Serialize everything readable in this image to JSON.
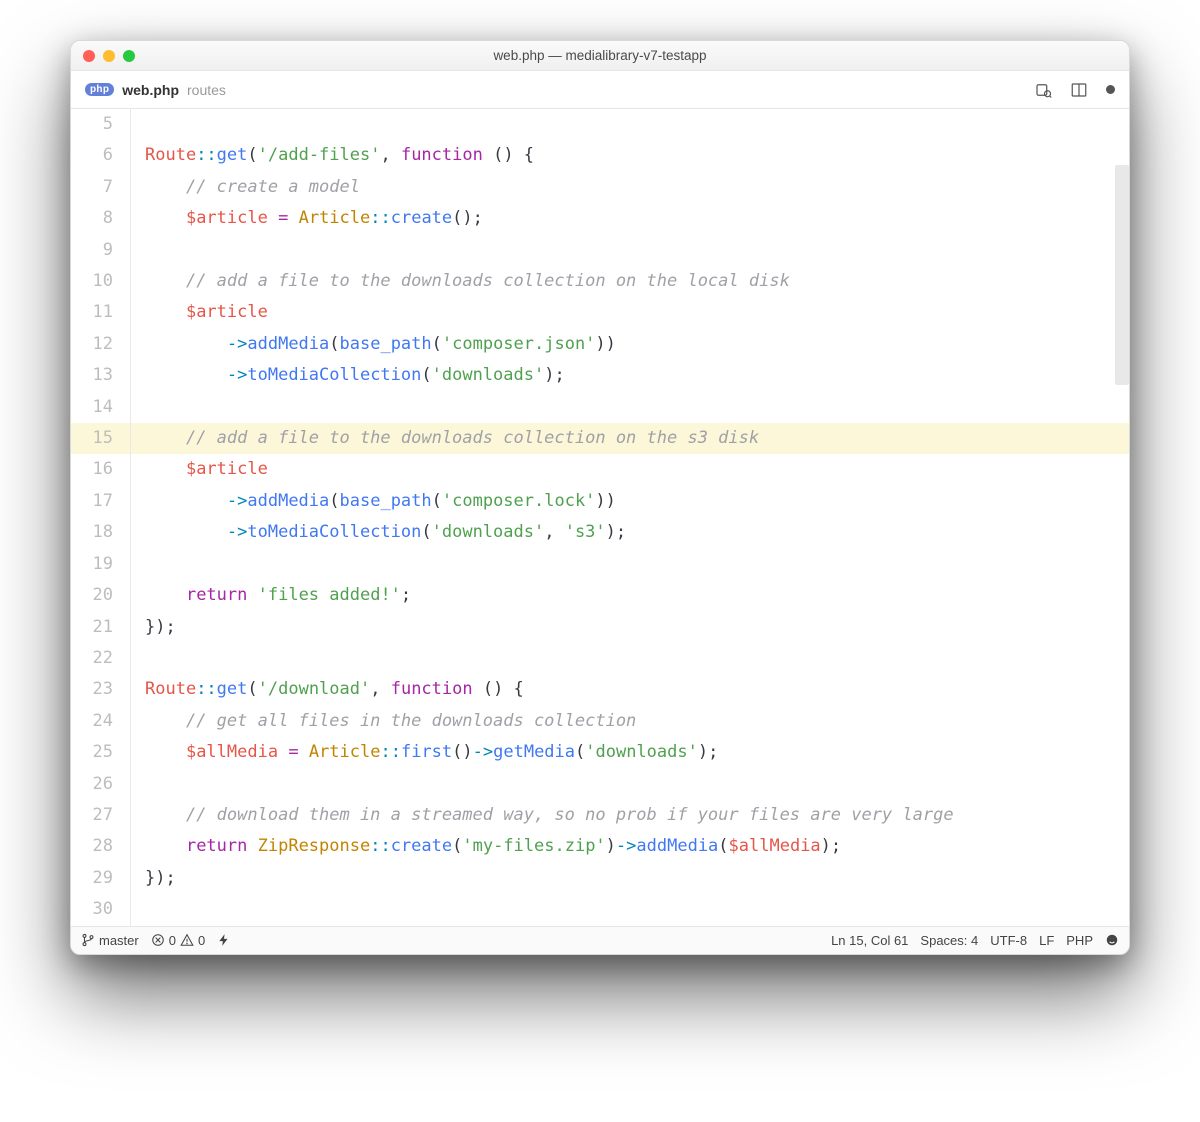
{
  "window": {
    "title": "web.php — medialibrary-v7-testapp"
  },
  "tab": {
    "icon_label": "php",
    "filename": "web.php",
    "path": "routes"
  },
  "editor": {
    "highlighted_line": 15,
    "lines": [
      {
        "n": 5,
        "tokens": []
      },
      {
        "n": 6,
        "tokens": [
          {
            "c": "name",
            "t": "Route"
          },
          {
            "c": "op",
            "t": "::"
          },
          {
            "c": "fn",
            "t": "get"
          },
          {
            "c": "p",
            "t": "("
          },
          {
            "c": "str",
            "t": "'/add-files'"
          },
          {
            "c": "p",
            "t": ", "
          },
          {
            "c": "kw",
            "t": "function"
          },
          {
            "c": "p",
            "t": " () {"
          }
        ]
      },
      {
        "n": 7,
        "tokens": [
          {
            "c": "p",
            "t": "    "
          },
          {
            "c": "comment",
            "t": "// create a model"
          }
        ]
      },
      {
        "n": 8,
        "tokens": [
          {
            "c": "p",
            "t": "    "
          },
          {
            "c": "name",
            "t": "$article"
          },
          {
            "c": "p",
            "t": " "
          },
          {
            "c": "kw",
            "t": "="
          },
          {
            "c": "p",
            "t": " "
          },
          {
            "c": "type",
            "t": "Article"
          },
          {
            "c": "op",
            "t": "::"
          },
          {
            "c": "fn",
            "t": "create"
          },
          {
            "c": "p",
            "t": "();"
          }
        ]
      },
      {
        "n": 9,
        "tokens": []
      },
      {
        "n": 10,
        "tokens": [
          {
            "c": "p",
            "t": "    "
          },
          {
            "c": "comment",
            "t": "// add a file to the downloads collection on the local disk"
          }
        ]
      },
      {
        "n": 11,
        "tokens": [
          {
            "c": "p",
            "t": "    "
          },
          {
            "c": "name",
            "t": "$article"
          }
        ]
      },
      {
        "n": 12,
        "tokens": [
          {
            "c": "p",
            "t": "        "
          },
          {
            "c": "op",
            "t": "->"
          },
          {
            "c": "fn",
            "t": "addMedia"
          },
          {
            "c": "p",
            "t": "("
          },
          {
            "c": "fn",
            "t": "base_path"
          },
          {
            "c": "p",
            "t": "("
          },
          {
            "c": "str",
            "t": "'composer.json'"
          },
          {
            "c": "p",
            "t": "))"
          }
        ]
      },
      {
        "n": 13,
        "tokens": [
          {
            "c": "p",
            "t": "        "
          },
          {
            "c": "op",
            "t": "->"
          },
          {
            "c": "fn",
            "t": "toMediaCollection"
          },
          {
            "c": "p",
            "t": "("
          },
          {
            "c": "str",
            "t": "'downloads'"
          },
          {
            "c": "p",
            "t": ");"
          }
        ]
      },
      {
        "n": 14,
        "tokens": []
      },
      {
        "n": 15,
        "tokens": [
          {
            "c": "p",
            "t": "    "
          },
          {
            "c": "comment",
            "t": "// add a file to the downloads collection on the s3 disk"
          }
        ]
      },
      {
        "n": 16,
        "tokens": [
          {
            "c": "p",
            "t": "    "
          },
          {
            "c": "name",
            "t": "$article"
          }
        ]
      },
      {
        "n": 17,
        "tokens": [
          {
            "c": "p",
            "t": "        "
          },
          {
            "c": "op",
            "t": "->"
          },
          {
            "c": "fn",
            "t": "addMedia"
          },
          {
            "c": "p",
            "t": "("
          },
          {
            "c": "fn",
            "t": "base_path"
          },
          {
            "c": "p",
            "t": "("
          },
          {
            "c": "str",
            "t": "'composer.lock'"
          },
          {
            "c": "p",
            "t": "))"
          }
        ]
      },
      {
        "n": 18,
        "tokens": [
          {
            "c": "p",
            "t": "        "
          },
          {
            "c": "op",
            "t": "->"
          },
          {
            "c": "fn",
            "t": "toMediaCollection"
          },
          {
            "c": "p",
            "t": "("
          },
          {
            "c": "str",
            "t": "'downloads'"
          },
          {
            "c": "p",
            "t": ", "
          },
          {
            "c": "str",
            "t": "'s3'"
          },
          {
            "c": "p",
            "t": ");"
          }
        ]
      },
      {
        "n": 19,
        "tokens": []
      },
      {
        "n": 20,
        "tokens": [
          {
            "c": "p",
            "t": "    "
          },
          {
            "c": "kw",
            "t": "return"
          },
          {
            "c": "p",
            "t": " "
          },
          {
            "c": "str",
            "t": "'files added!'"
          },
          {
            "c": "p",
            "t": ";"
          }
        ]
      },
      {
        "n": 21,
        "tokens": [
          {
            "c": "p",
            "t": "});"
          }
        ]
      },
      {
        "n": 22,
        "tokens": []
      },
      {
        "n": 23,
        "tokens": [
          {
            "c": "name",
            "t": "Route"
          },
          {
            "c": "op",
            "t": "::"
          },
          {
            "c": "fn",
            "t": "get"
          },
          {
            "c": "p",
            "t": "("
          },
          {
            "c": "str",
            "t": "'/download'"
          },
          {
            "c": "p",
            "t": ", "
          },
          {
            "c": "kw",
            "t": "function"
          },
          {
            "c": "p",
            "t": " () {"
          }
        ]
      },
      {
        "n": 24,
        "tokens": [
          {
            "c": "p",
            "t": "    "
          },
          {
            "c": "comment",
            "t": "// get all files in the downloads collection"
          }
        ]
      },
      {
        "n": 25,
        "tokens": [
          {
            "c": "p",
            "t": "    "
          },
          {
            "c": "name",
            "t": "$allMedia"
          },
          {
            "c": "p",
            "t": " "
          },
          {
            "c": "kw",
            "t": "="
          },
          {
            "c": "p",
            "t": " "
          },
          {
            "c": "type",
            "t": "Article"
          },
          {
            "c": "op",
            "t": "::"
          },
          {
            "c": "fn",
            "t": "first"
          },
          {
            "c": "p",
            "t": "()"
          },
          {
            "c": "op",
            "t": "->"
          },
          {
            "c": "fn",
            "t": "getMedia"
          },
          {
            "c": "p",
            "t": "("
          },
          {
            "c": "str",
            "t": "'downloads'"
          },
          {
            "c": "p",
            "t": ");"
          }
        ]
      },
      {
        "n": 26,
        "tokens": []
      },
      {
        "n": 27,
        "tokens": [
          {
            "c": "p",
            "t": "    "
          },
          {
            "c": "comment",
            "t": "// download them in a streamed way, so no prob if your files are very large"
          }
        ]
      },
      {
        "n": 28,
        "tokens": [
          {
            "c": "p",
            "t": "    "
          },
          {
            "c": "kw",
            "t": "return"
          },
          {
            "c": "p",
            "t": " "
          },
          {
            "c": "type",
            "t": "ZipResponse"
          },
          {
            "c": "op",
            "t": "::"
          },
          {
            "c": "fn",
            "t": "create"
          },
          {
            "c": "p",
            "t": "("
          },
          {
            "c": "str",
            "t": "'my-files.zip'"
          },
          {
            "c": "p",
            "t": ")"
          },
          {
            "c": "op",
            "t": "->"
          },
          {
            "c": "fn",
            "t": "addMedia"
          },
          {
            "c": "p",
            "t": "("
          },
          {
            "c": "name",
            "t": "$allMedia"
          },
          {
            "c": "p",
            "t": ");"
          }
        ]
      },
      {
        "n": 29,
        "tokens": [
          {
            "c": "p",
            "t": "});"
          }
        ]
      },
      {
        "n": 30,
        "tokens": []
      }
    ]
  },
  "status": {
    "branch": "master",
    "errors": "0",
    "warnings": "0",
    "cursor": "Ln 15, Col 61",
    "spaces": "Spaces: 4",
    "encoding": "UTF-8",
    "eol": "LF",
    "language": "PHP"
  }
}
